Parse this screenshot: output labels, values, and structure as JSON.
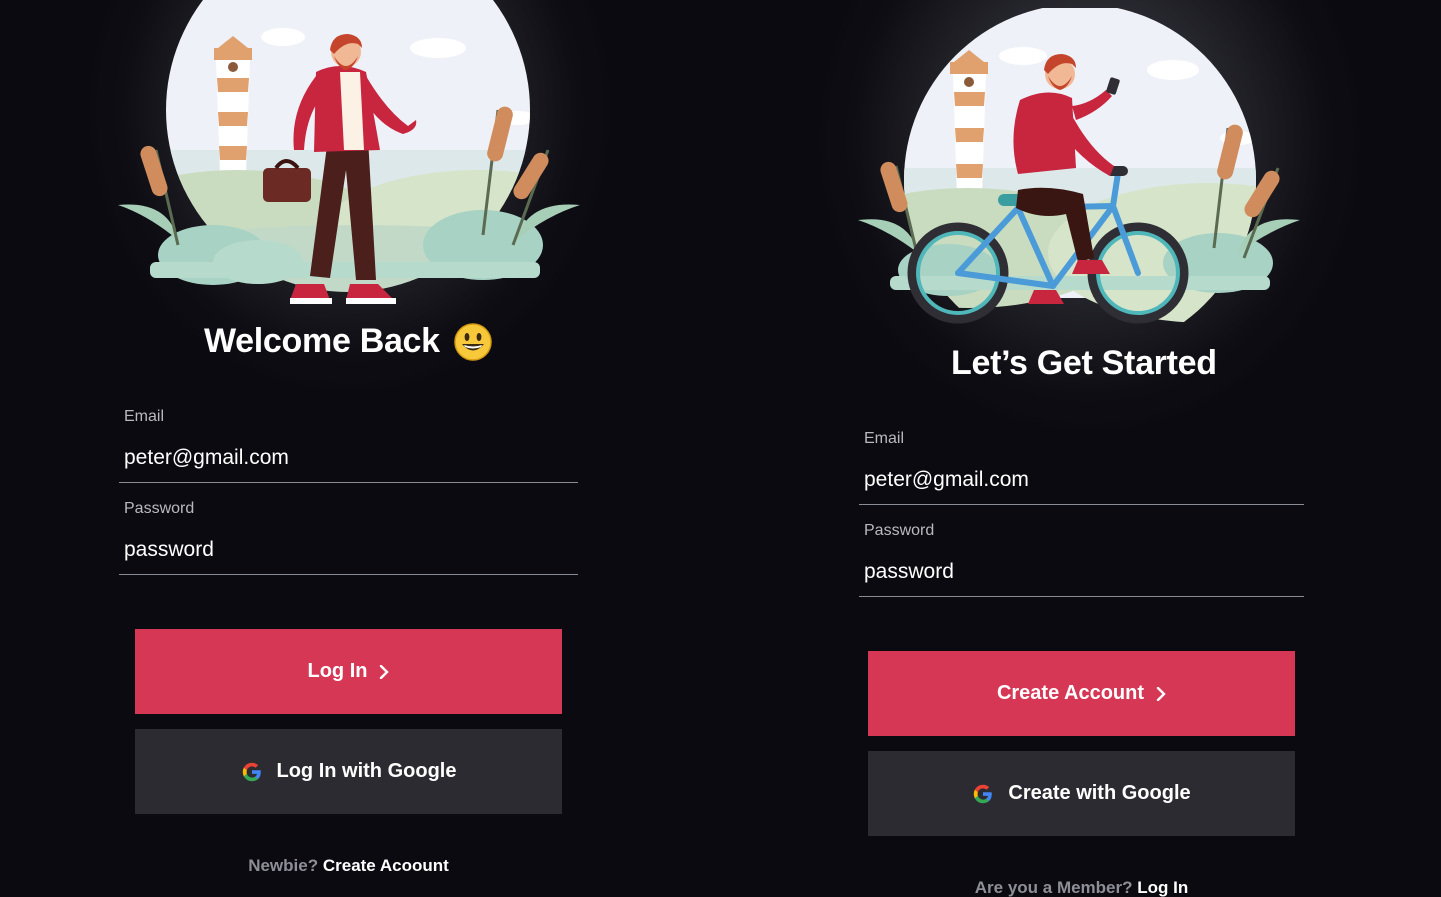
{
  "login": {
    "title": "Welcome Back",
    "title_emoji": "grinning-face-emoji",
    "email_label": "Email",
    "email_value": "peter@gmail.com",
    "password_label": "Password",
    "password_value": "password",
    "primary_button": "Log In",
    "google_button": "Log In with Google",
    "footer_prompt": "Newbie?",
    "footer_link": "Create Acoount"
  },
  "signup": {
    "title": "Let’s Get Started",
    "email_label": "Email",
    "email_value": "peter@gmail.com",
    "password_label": "Password",
    "password_value": "password",
    "primary_button": "Create Account",
    "google_button": "Create with Google",
    "footer_prompt": "Are you a Member?",
    "footer_link": "Log In"
  },
  "colors": {
    "background": "#0b0a10",
    "primary": "#d63755",
    "secondary": "#2b2b31",
    "input_underline": "#8a8a92",
    "muted_text": "#8e8e96"
  },
  "icons": {
    "chevron": "chevron-right-icon",
    "google": "google-g-icon"
  }
}
